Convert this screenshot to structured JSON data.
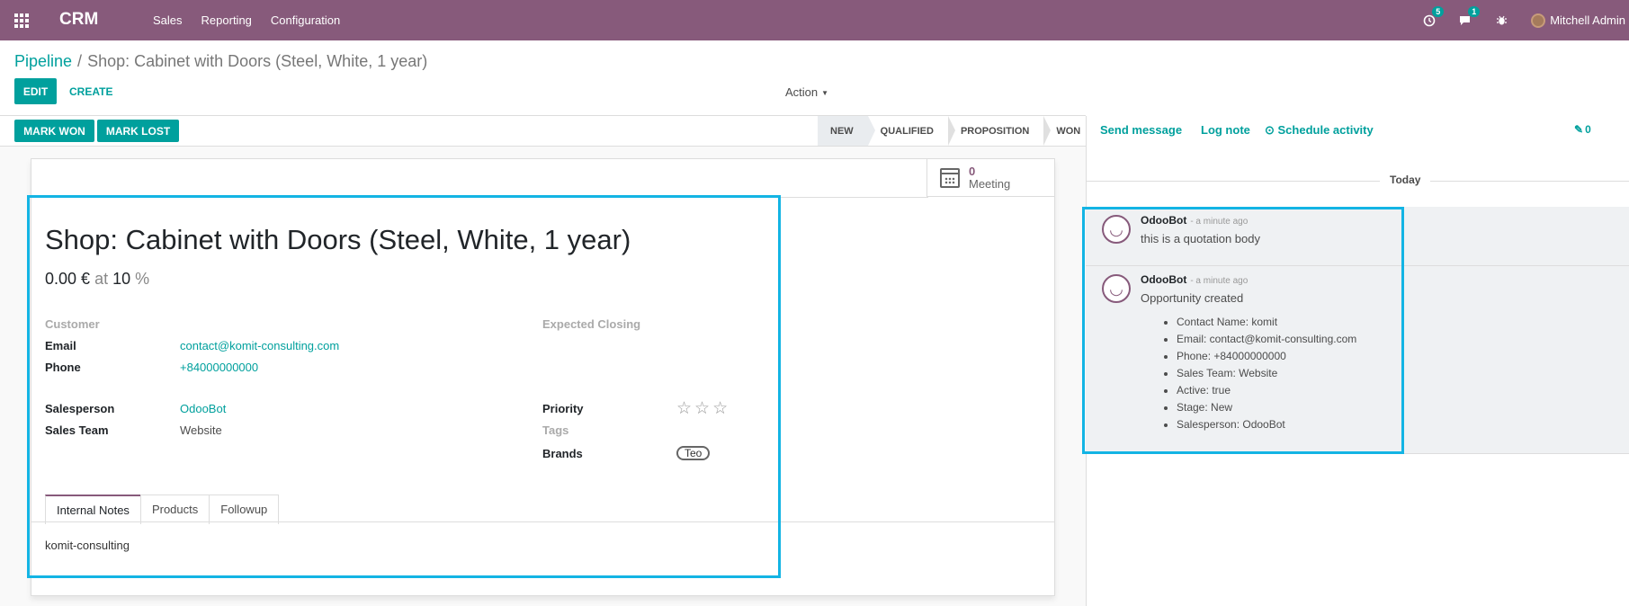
{
  "navbar": {
    "app_name": "CRM",
    "menu": [
      "Sales",
      "Reporting",
      "Configuration"
    ],
    "activity_count": "5",
    "message_count": "1",
    "user": "Mitchell Admin"
  },
  "breadcrumb": {
    "parent": "Pipeline",
    "separator": "/",
    "current": "Shop: Cabinet with Doors (Steel, White, 1 year)"
  },
  "toolbar": {
    "edit": "EDIT",
    "create": "CREATE",
    "action": "Action"
  },
  "statusbar": {
    "mark_won": "MARK WON",
    "mark_lost": "MARK LOST",
    "stages": [
      "NEW",
      "QUALIFIED",
      "PROPOSITION",
      "WON"
    ],
    "active_stage": "NEW"
  },
  "smart_button": {
    "value": "0",
    "label": "Meeting"
  },
  "lead": {
    "title": "Shop: Cabinet with Doors (Steel, White, 1 year)",
    "revenue": "0.00 €",
    "at": "at",
    "probability": "10",
    "percent": "%"
  },
  "fields": {
    "customer_label": "Customer",
    "email_label": "Email",
    "email": "contact@komit-consulting.com",
    "phone_label": "Phone",
    "phone": "+84000000000",
    "salesperson_label": "Salesperson",
    "salesperson": "OdooBot",
    "sales_team_label": "Sales Team",
    "sales_team": "Website",
    "expected_closing_label": "Expected Closing",
    "priority_label": "Priority",
    "priority_stars": 0,
    "tags_label": "Tags",
    "brands_label": "Brands",
    "brand_tag": "Teo"
  },
  "tabs": {
    "items": [
      "Internal Notes",
      "Products",
      "Followup"
    ],
    "active": "Internal Notes",
    "content": "komit-consulting"
  },
  "chatter": {
    "send_message": "Send message",
    "log_note": "Log note",
    "schedule_activity": "Schedule activity",
    "attachment_count": "0",
    "date_separator": "Today",
    "messages": [
      {
        "author": "OdooBot",
        "time": "- a minute ago",
        "body": "this is a quotation body"
      },
      {
        "author": "OdooBot",
        "time": "- a minute ago",
        "body": "Opportunity created",
        "items": [
          "Contact Name: komit",
          "Email: contact@komit-consulting.com",
          "Phone: +84000000000",
          "Sales Team: Website",
          "Active: true",
          "Stage: New",
          "Salesperson: OdooBot"
        ]
      }
    ]
  },
  "colors": {
    "brand": "#875a7b",
    "accent": "#00a09d",
    "highlight": "#13b4e4"
  }
}
